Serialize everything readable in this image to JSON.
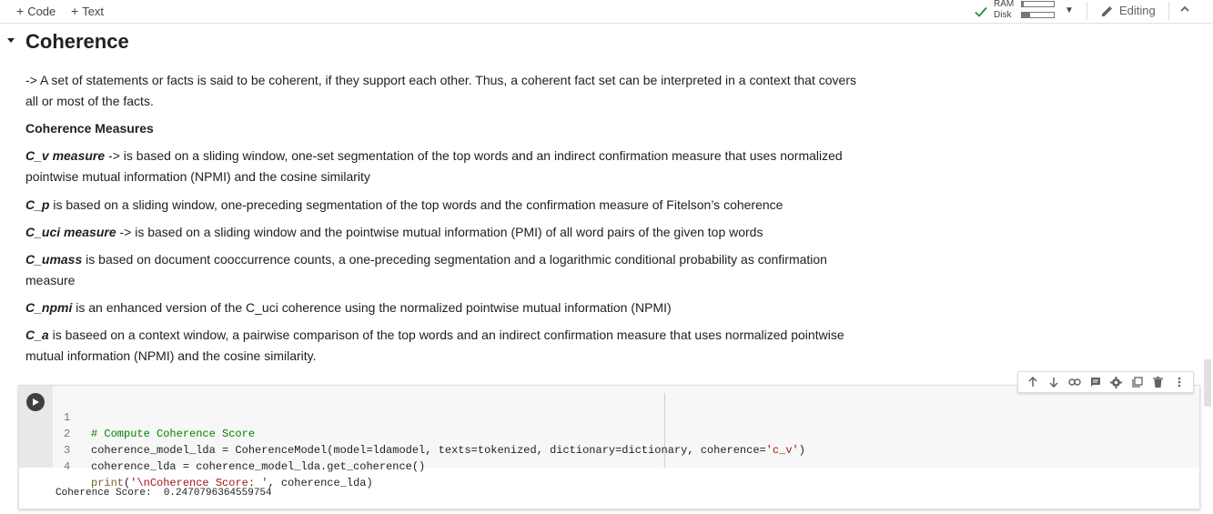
{
  "toolbar": {
    "add_code": "Code",
    "add_text": "Text",
    "ram_label": "RAM",
    "disk_label": "Disk",
    "ram_usage": 0.05,
    "disk_usage": 0.25,
    "editing_label": "Editing",
    "connected_color": "#1e8e3e"
  },
  "section": {
    "title": "Coherence"
  },
  "text": {
    "intro": "-> A set of statements or facts is said to be coherent, if they support each other. Thus, a coherent fact set can be interpreted in a context that covers all or most of the facts.",
    "measures_heading": "Coherence Measures",
    "items": [
      {
        "term": "C_v measure",
        "desc": " -> is based on a sliding window, one-set segmentation of the top words and an indirect confirmation measure that uses normalized pointwise mutual information (NPMI) and the cosine similarity"
      },
      {
        "term": "C_p",
        "desc": " is based on a sliding window, one-preceding segmentation of the top words and the confirmation measure of Fitelson’s coherence"
      },
      {
        "term": "C_uci measure",
        "desc": " -> is based on a sliding window and the pointwise mutual information (PMI) of all word pairs of the given top words"
      },
      {
        "term": "C_umass",
        "desc": " is based on document cooccurrence counts, a one-preceding segmentation and a logarithmic conditional probability as confirmation measure"
      },
      {
        "term": "C_npmi",
        "desc": " is an enhanced version of the C_uci coherence using the normalized pointwise mutual information (NPMI)"
      },
      {
        "term": "C_a",
        "desc": " is baseed on a context window, a pairwise comparison of the top words and an indirect confirmation measure that uses normalized pointwise mutual information (NPMI) and the cosine similarity."
      }
    ]
  },
  "code": {
    "lines": [
      {
        "num": "1",
        "text": "# Compute Coherence Score"
      },
      {
        "num": "2",
        "text": "coherence_model_lda = CoherenceModel(model=ldamodel, texts=tokenized, dictionary=dictionary, coherence='c_v')"
      },
      {
        "num": "3",
        "text": "coherence_lda = coherence_model_lda.get_coherence()"
      },
      {
        "num": "4",
        "text": "print('\\nCoherence Score: ', coherence_lda)"
      }
    ],
    "output": "Coherence Score:  0.2470796364559754"
  },
  "cell_toolbar": {
    "icons": [
      "arrow-up-icon",
      "arrow-down-icon",
      "link-icon",
      "comment-icon",
      "settings-icon",
      "mirror-cell-icon",
      "delete-icon",
      "more-icon"
    ]
  }
}
